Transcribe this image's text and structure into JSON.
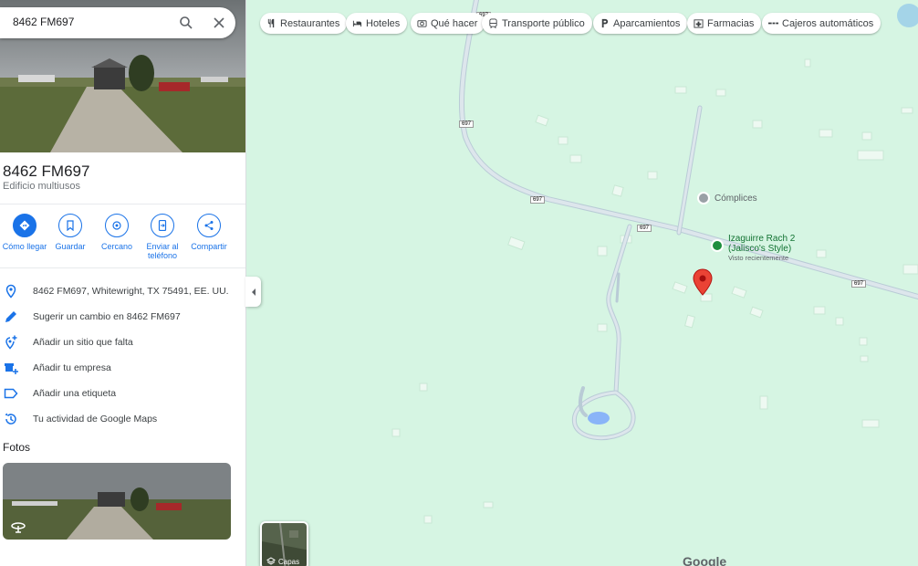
{
  "search": {
    "value": "8462 FM697"
  },
  "place": {
    "title": "8462 FM697",
    "subtitle": "Edificio multiusos"
  },
  "actions": [
    {
      "label": "Cómo llegar",
      "icon": "directions-icon"
    },
    {
      "label": "Guardar",
      "icon": "bookmark-icon"
    },
    {
      "label": "Cercano",
      "icon": "nearby-icon"
    },
    {
      "label": "Enviar al teléfono",
      "icon": "send-to-phone-icon"
    },
    {
      "label": "Compartir",
      "icon": "share-icon"
    }
  ],
  "info": [
    {
      "text": "8462 FM697, Whitewright, TX 75491, EE. UU.",
      "icon": "location-pin-icon"
    },
    {
      "text": "Sugerir un cambio en 8462 FM697",
      "icon": "pencil-icon"
    },
    {
      "text": "Añadir un sitio que falta",
      "icon": "add-place-icon"
    },
    {
      "text": "Añadir tu empresa",
      "icon": "add-business-icon"
    },
    {
      "text": "Añadir una etiqueta",
      "icon": "label-icon"
    },
    {
      "text": "Tu actividad de Google Maps",
      "icon": "history-icon"
    }
  ],
  "photos": {
    "heading": "Fotos"
  },
  "chips": [
    {
      "label": "Restaurantes",
      "icon": "restaurant-icon"
    },
    {
      "label": "Hoteles",
      "icon": "hotel-icon"
    },
    {
      "label": "Qué hacer",
      "icon": "camera-icon"
    },
    {
      "label": "Transporte público",
      "icon": "transit-icon"
    },
    {
      "label": "Aparcamientos",
      "icon": "parking-icon"
    },
    {
      "label": "Farmacias",
      "icon": "pharmacy-icon"
    },
    {
      "label": "Cajeros automáticos",
      "icon": "atm-icon"
    }
  ],
  "map": {
    "road_shields": [
      "697",
      "697",
      "697",
      "697",
      "697"
    ],
    "poi_complices": "Cómplices",
    "poi_izaguirre": "Izaguirre Rach 2",
    "poi_izaguirre_2": "(Jalisco's Style)",
    "poi_izaguirre_status": "Visto recientemente",
    "layers_label": "Capas",
    "logo": "Google"
  },
  "colors": {
    "accent": "#1a73e8",
    "map_bg": "#d6f5e3",
    "marker": "#ea4335"
  }
}
